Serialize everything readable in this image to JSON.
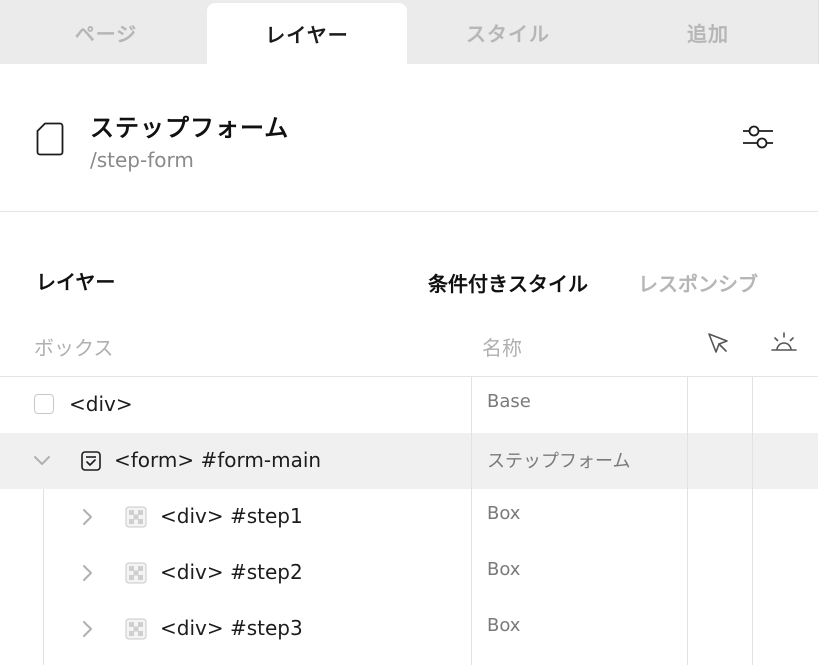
{
  "tabs": {
    "page": "ページ",
    "layer": "レイヤー",
    "style": "スタイル",
    "add": "追加"
  },
  "page": {
    "title": "ステップフォーム",
    "path": "/step-form"
  },
  "layers": {
    "title": "レイヤー",
    "conditional_style": "条件付きスタイル",
    "responsive": "レスポンシブ",
    "col_box": "ボックス",
    "col_name": "名称"
  },
  "rows": [
    {
      "label": "<div>",
      "name": "Base"
    },
    {
      "label": "<form> #form-main",
      "name": "ステップフォーム"
    },
    {
      "label": "<div> #step1",
      "name": "Box"
    },
    {
      "label": "<div> #step2",
      "name": "Box"
    },
    {
      "label": "<div> #step3",
      "name": "Box"
    }
  ],
  "icons": {
    "document": "document-icon",
    "settings": "sliders-icon",
    "cursor": "cursor-icon",
    "sunrise": "sunrise-icon",
    "form": "form-icon",
    "box": "checker-icon",
    "chevron_down": "chevron-down-icon",
    "chevron_right": "chevron-right-icon"
  }
}
